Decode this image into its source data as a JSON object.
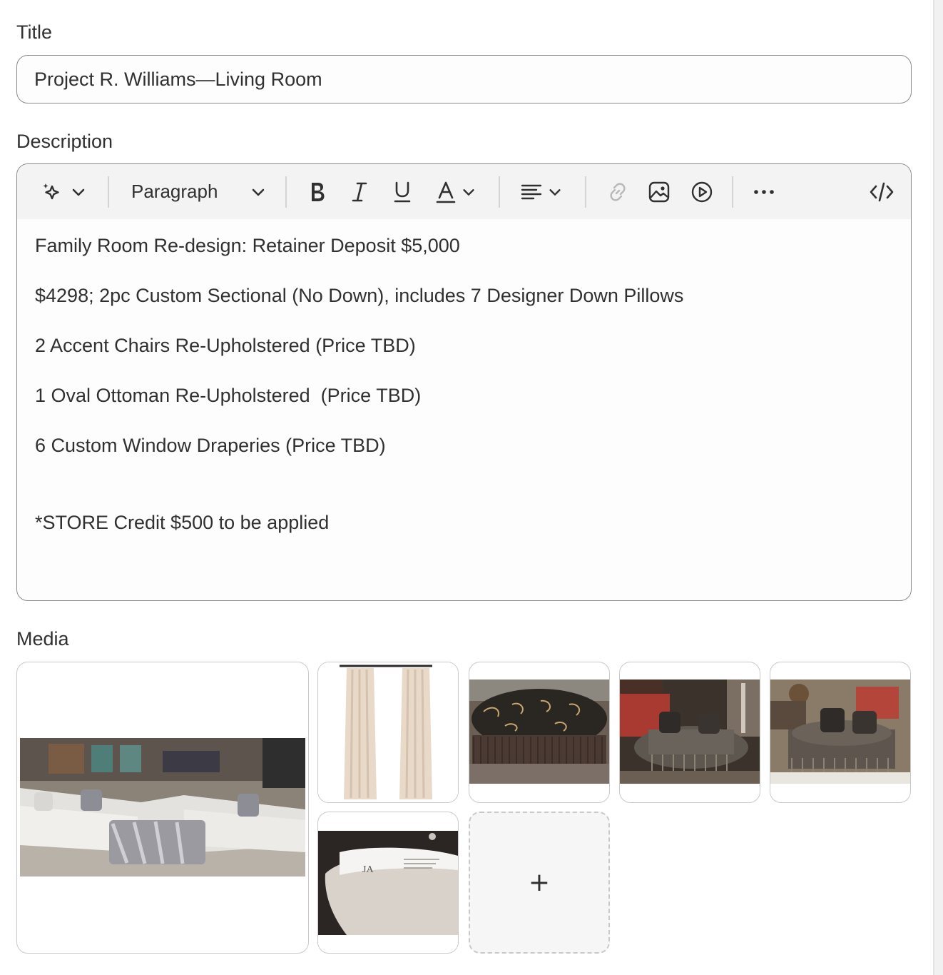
{
  "title_field": {
    "label": "Title",
    "value": "Project R. Williams—Living Room"
  },
  "description": {
    "label": "Description",
    "toolbar": {
      "items": [
        "magic-icon",
        "chevron-down-icon",
        "bold-icon",
        "italic-icon",
        "underline-icon",
        "text-color-icon",
        "align-icon",
        "link-icon",
        "image-icon",
        "video-icon",
        "more-icon",
        "code-icon"
      ],
      "block_format": "Paragraph"
    },
    "lines": [
      "Family Room Re-design: Retainer Deposit $5,000",
      "$4298; 2pc Custom Sectional (No Down), includes 7 Designer Down Pillows",
      "2 Accent Chairs Re-Upholstered (Price TBD)",
      "1 Oval Ottoman Re-Upholstered  (Price TBD)",
      "6 Custom Window Draperies (Price TBD)",
      "*STORE Credit $500 to be applied"
    ]
  },
  "media": {
    "label": "Media",
    "items": [
      {
        "name": "sectional-sofa-photo"
      },
      {
        "name": "curtains-photo"
      },
      {
        "name": "ottoman-photo"
      },
      {
        "name": "living-room-photo-1"
      },
      {
        "name": "living-room-photo-2"
      },
      {
        "name": "fabric-sample-photo"
      }
    ],
    "add_label": "+"
  }
}
